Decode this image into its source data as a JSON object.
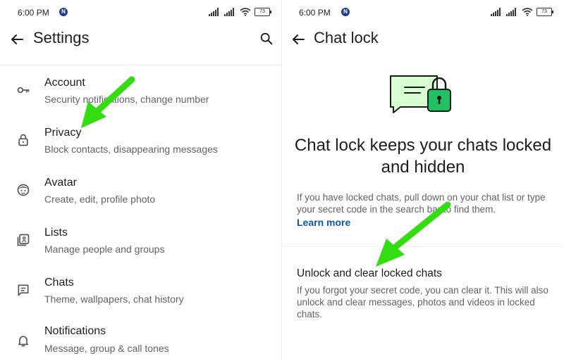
{
  "left": {
    "status": {
      "time": "6:00 PM",
      "notif_badge": "N",
      "battery": "73"
    },
    "title": "Settings",
    "items": [
      {
        "title": "Account",
        "subtitle": "Security notifications, change number",
        "icon": "key-icon"
      },
      {
        "title": "Privacy",
        "subtitle": "Block contacts, disappearing messages",
        "icon": "lock-icon"
      },
      {
        "title": "Avatar",
        "subtitle": "Create, edit, profile photo",
        "icon": "avatar-icon"
      },
      {
        "title": "Lists",
        "subtitle": "Manage people and groups",
        "icon": "lists-icon"
      },
      {
        "title": "Chats",
        "subtitle": "Theme, wallpapers, chat history",
        "icon": "chat-icon"
      },
      {
        "title": "Notifications",
        "subtitle": "Message, group & call tones",
        "icon": "bell-icon"
      }
    ]
  },
  "right": {
    "status": {
      "time": "6:00 PM",
      "notif_badge": "N",
      "battery": "73"
    },
    "title": "Chat lock",
    "heading": "Chat lock keeps your chats locked and hidden",
    "body": "If you have locked chats, pull down on your chat list or type your secret code in the search bar to find them.",
    "learn_more": "Learn more",
    "option_title": "Unlock and clear locked chats",
    "option_body": "If you forgot your secret code, you can clear it. This will also unlock and clear messages, photos and videos in locked chats."
  },
  "colors": {
    "accent_green": "#21c063",
    "hero_light": "#d9fdd3",
    "link_blue": "#0b57a7",
    "arrow_green": "#33dd11"
  }
}
